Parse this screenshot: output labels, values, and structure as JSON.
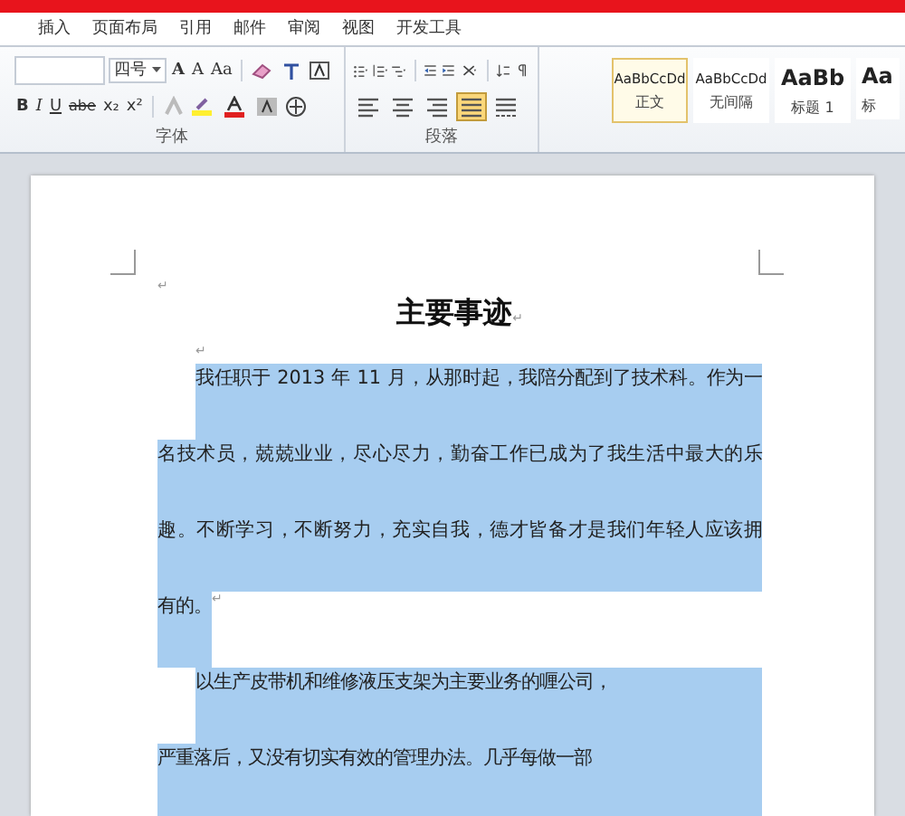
{
  "tabs": [
    {
      "label": "插入",
      "selected": false
    },
    {
      "label": "页面布局",
      "selected": false
    },
    {
      "label": "引用",
      "selected": false
    },
    {
      "label": "邮件",
      "selected": false
    },
    {
      "label": "审阅",
      "selected": false
    },
    {
      "label": "视图",
      "selected": false
    },
    {
      "label": "开发工具",
      "selected": false
    }
  ],
  "font_group": {
    "label": "字体",
    "font_size": "四号",
    "row1_buttons": [
      "A",
      "A",
      "Aa"
    ],
    "row2_buttons": [
      "B",
      "I",
      "U",
      "abe",
      "x₂",
      "x²"
    ]
  },
  "paragraph_group": {
    "label": "段落",
    "alignments": [
      {
        "kind": "left",
        "selected": false
      },
      {
        "kind": "center",
        "selected": false
      },
      {
        "kind": "right",
        "selected": false
      },
      {
        "kind": "justify",
        "selected": true
      },
      {
        "kind": "distributed",
        "selected": false
      }
    ]
  },
  "styles": [
    {
      "preview": "AaBbCcDd",
      "name": "正文",
      "kind": "body",
      "selected": true
    },
    {
      "preview": "AaBbCcDd",
      "name": "无间隔",
      "kind": "body",
      "selected": false
    },
    {
      "preview": "AaBb",
      "name": "标题 1",
      "kind": "heading",
      "selected": false
    },
    {
      "preview": "Aa",
      "name": "标",
      "kind": "heading",
      "selected": false
    }
  ],
  "document": {
    "blocks": [
      {
        "kind": "mark",
        "mark": "↵"
      },
      {
        "kind": "title",
        "text": "主要事迹",
        "mark": "↵"
      },
      {
        "kind": "mark",
        "mark": "↵"
      },
      {
        "kind": "paragraph",
        "selected": true,
        "lines": [
          "我任职于 2013 年 11 月，从那时起，我陪分配到了技术科。作为一",
          "名技术员，兢兢业业，尽心尽力，勤奋工作已成为了我生活中最大的乐",
          "趣。不断学习，不断努力，充实自我，德才皆备才是我们年轻人应该拥",
          "有的。"
        ],
        "mark": "↵"
      },
      {
        "kind": "paragraph",
        "selected": true,
        "lines": [
          "以生产皮带机和维修液压支架为主要业务的喱公司，",
          "严重落后，又没有切实有效的管理办法。几乎每做一部"
        ]
      }
    ]
  }
}
